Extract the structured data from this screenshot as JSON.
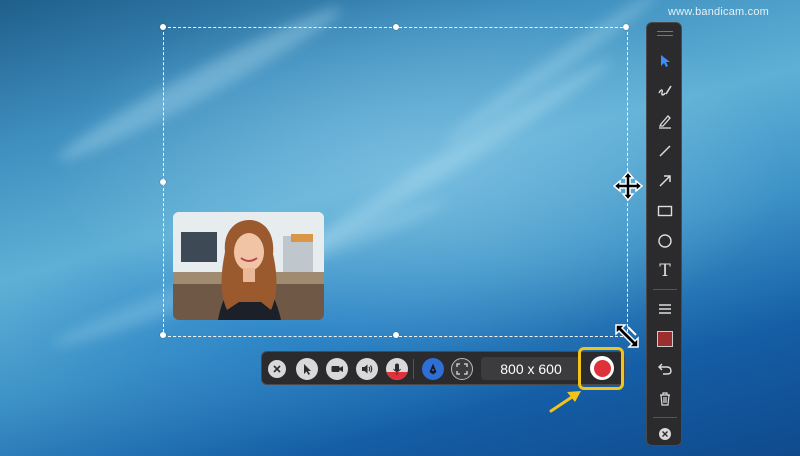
{
  "watermark": "www.bandicam.com",
  "capture": {
    "size_label": "800 x 600"
  },
  "side_toolbar": {
    "tools": [
      "select-cursor",
      "pen",
      "highlighter",
      "line",
      "arrow",
      "rectangle",
      "ellipse",
      "text",
      "line-width",
      "color",
      "undo",
      "delete"
    ],
    "text_tool_label": "T",
    "color": "#9b2e2e",
    "accent": "#3f8cff"
  },
  "bottom_toolbar": {
    "buttons": [
      "close",
      "cursor",
      "webcam",
      "speaker",
      "microphone",
      "drawing",
      "fullscreen",
      "record"
    ],
    "record_color": "#e0313a",
    "highlight_color": "#f2c318"
  }
}
